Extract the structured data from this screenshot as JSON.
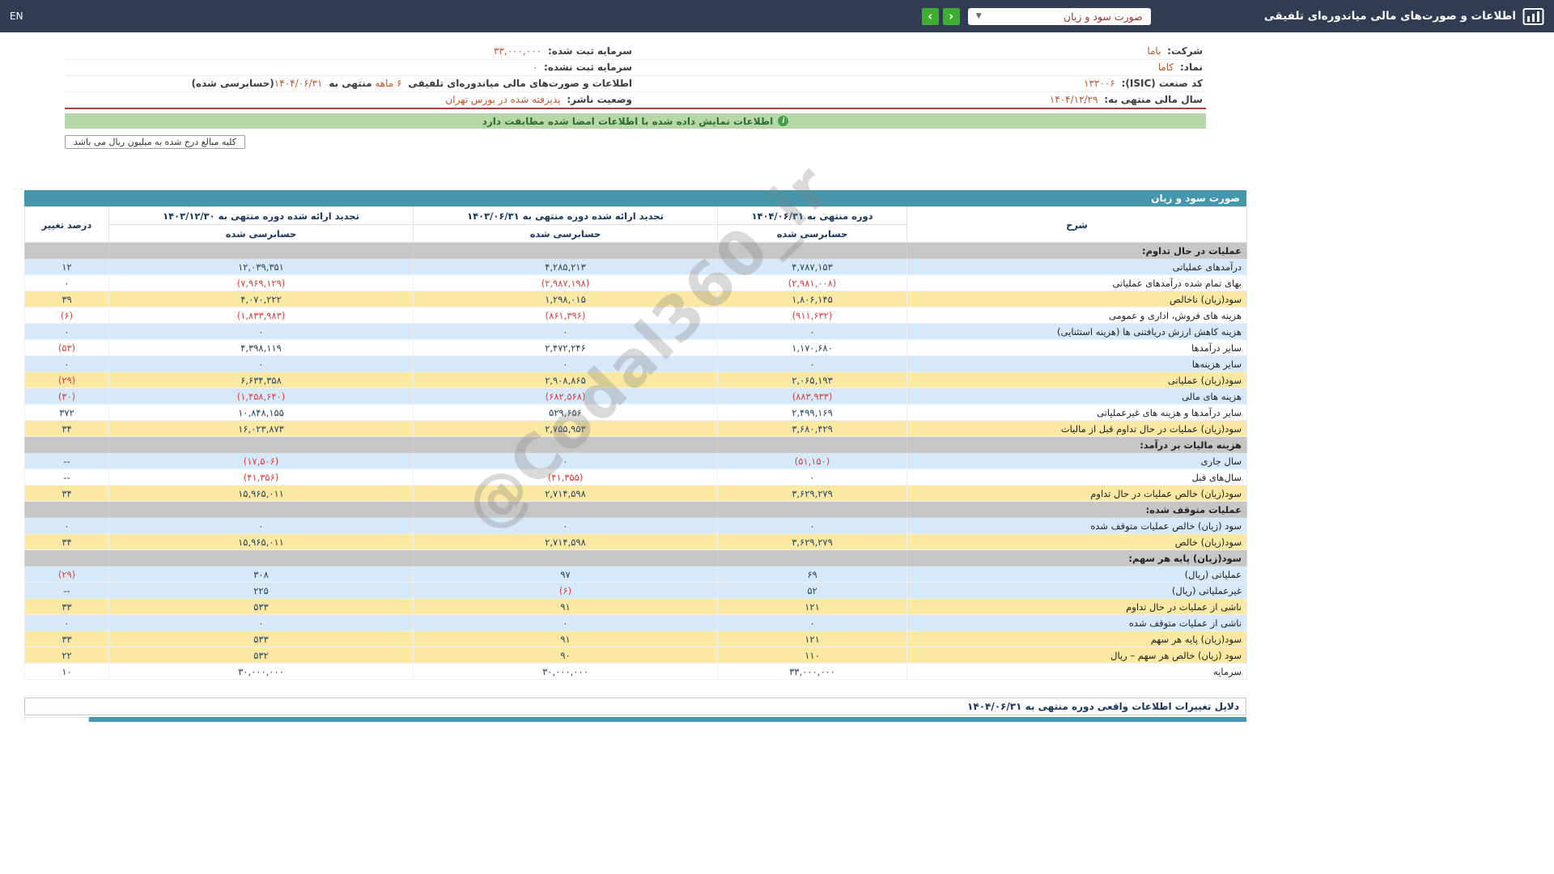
{
  "topbar": {
    "en": "EN",
    "title": "اطلاعات و صورت‌های مالی میاندوره‌ای تلفیقی",
    "statement_dropdown": "صورت سود و زیان",
    "nav_prev": "‹",
    "nav_next": "›"
  },
  "company_info": {
    "company_label": "شرکت:",
    "company_value": "باما",
    "symbol_label": "نماد:",
    "symbol_value": "کاما",
    "isic_label": "کد صنعت (ISIC):",
    "isic_value": "۱۳۲۰۰۶",
    "fiscal_year_label": "سال مالی منتهی به:",
    "fiscal_year_value": "۱۴۰۴/۱۲/۲۹",
    "registered_capital_label": "سرمایه ثبت شده:",
    "registered_capital_value": "۳۳,۰۰۰,۰۰۰",
    "unregistered_capital_label": "سرمایه ثبت نشده:",
    "unregistered_capital_value": "۰",
    "report_desc_prefix": "اطلاعات و صورت‌های مالی میاندوره‌ای تلفیقی",
    "report_desc_period": "۶ ماهه",
    "report_desc_middle": "منتهی به",
    "report_desc_date": "۱۴۰۴/۰۶/۳۱",
    "report_desc_suffix": "(حسابرسی شده)",
    "issuer_status_label": "وضعیت ناشر:",
    "issuer_status_value": "پذیرفته شده در بورس تهران"
  },
  "notice": {
    "text": "اطلاعات نمایش داده شده با اطلاعات امضا شده مطابقت دارد"
  },
  "amounts_note": "کلیه مبالغ درج شده به میلیون ریال می باشد",
  "statement_table": {
    "title": "صورت سود و زیان",
    "col_desc": "شرح",
    "col_period1": "دوره منتهی به ۱۴۰۴/۰۶/۳۱",
    "col_period2": "تجدید ارائه شده دوره منتهی به ۱۴۰۳/۰۶/۳۱",
    "col_period3": "تجدید ارائه شده دوره منتهی به ۱۴۰۳/۱۲/۳۰",
    "col_pct": "درصد تغییر",
    "audited_label": "حسابرسی شده",
    "rows": [
      {
        "label": "عملیات در حال تداوم:",
        "style": "section",
        "v1": "",
        "v2": "",
        "v3": "",
        "pct": ""
      },
      {
        "label": "درآمدهای عملیاتی",
        "style": "blue",
        "v1": "۴,۷۸۷,۱۵۳",
        "v2": "۴,۲۸۵,۲۱۳",
        "v3": "۱۲,۰۳۹,۳۵۱",
        "pct": "۱۲"
      },
      {
        "label": "بهای تمام شده درآمدهای عملیاتی",
        "style": "white",
        "v1": "(۲,۹۸۱,۰۰۸)",
        "v2": "(۲,۹۸۷,۱۹۸)",
        "v3": "(۷,۹۶۹,۱۲۹)",
        "pct": "۰"
      },
      {
        "label": "سود(زیان) ناخالص",
        "style": "yellow",
        "v1": "۱,۸۰۶,۱۴۵",
        "v2": "۱,۲۹۸,۰۱۵",
        "v3": "۴,۰۷۰,۲۲۲",
        "pct": "۳۹"
      },
      {
        "label": "هزینه های فروش، اداری و عمومی",
        "style": "white",
        "v1": "(۹۱۱,۶۳۲)",
        "v2": "(۸۶۱,۳۹۶)",
        "v3": "(۱,۸۳۳,۹۸۳)",
        "pct": "(۶)"
      },
      {
        "label": "هزینه کاهش ارزش دریافتنی ها (هزینه استثنایی)",
        "style": "blue",
        "v1": "۰",
        "v2": "۰",
        "v3": "۰",
        "pct": "۰"
      },
      {
        "label": "سایر درآمدها",
        "style": "white",
        "v1": "۱,۱۷۰,۶۸۰",
        "v2": "۲,۴۷۲,۲۴۶",
        "v3": "۴,۳۹۸,۱۱۹",
        "pct": "(۵۳)"
      },
      {
        "label": "سایر هزینه‌ها",
        "style": "blue",
        "v1": "۰",
        "v2": "۰",
        "v3": "۰",
        "pct": "۰"
      },
      {
        "label": "سود(زیان) عملیاتی",
        "style": "yellow",
        "v1": "۲,۰۶۵,۱۹۳",
        "v2": "۲,۹۰۸,۸۶۵",
        "v3": "۶,۶۳۴,۳۵۸",
        "pct": "(۲۹)"
      },
      {
        "label": "هزینه های مالی",
        "style": "blue",
        "v1": "(۸۸۳,۹۳۳)",
        "v2": "(۶۸۲,۵۶۸)",
        "v3": "(۱,۴۵۸,۶۴۰)",
        "pct": "(۳۰)"
      },
      {
        "label": "سایر درآمدها و هزینه های غیرعملیاتی",
        "style": "white",
        "v1": "۲,۴۹۹,۱۶۹",
        "v2": "۵۲۹,۶۵۶",
        "v3": "۱۰,۸۴۸,۱۵۵",
        "pct": "۳۷۲"
      },
      {
        "label": "سود(زیان) عملیات در حال تداوم قبل از مالیات",
        "style": "yellow",
        "v1": "۳,۶۸۰,۴۲۹",
        "v2": "۲,۷۵۵,۹۵۳",
        "v3": "۱۶,۰۲۳,۸۷۳",
        "pct": "۳۴"
      },
      {
        "label": "هزینه مالیات بر درآمد:",
        "style": "section",
        "v1": "",
        "v2": "",
        "v3": "",
        "pct": ""
      },
      {
        "label": "سال جاری",
        "style": "blue",
        "v1": "(۵۱,۱۵۰)",
        "v2": "۰",
        "v3": "(۱۷,۵۰۶)",
        "pct": "--"
      },
      {
        "label": "سال‌های قبل",
        "style": "white",
        "v1": "۰",
        "v2": "(۴۱,۳۵۵)",
        "v3": "(۴۱,۳۵۶)",
        "pct": "--"
      },
      {
        "label": "سود(زیان) خالص عملیات در حال تداوم",
        "style": "yellow",
        "v1": "۳,۶۲۹,۲۷۹",
        "v2": "۲,۷۱۴,۵۹۸",
        "v3": "۱۵,۹۶۵,۰۱۱",
        "pct": "۳۴"
      },
      {
        "label": "عملیات متوقف شده:",
        "style": "section",
        "v1": "",
        "v2": "",
        "v3": "",
        "pct": ""
      },
      {
        "label": "سود (زیان) خالص عملیات متوقف شده",
        "style": "blue",
        "v1": "۰",
        "v2": "۰",
        "v3": "۰",
        "pct": "۰"
      },
      {
        "label": "سود(زیان) خالص",
        "style": "yellow",
        "v1": "۳,۶۲۹,۲۷۹",
        "v2": "۲,۷۱۴,۵۹۸",
        "v3": "۱۵,۹۶۵,۰۱۱",
        "pct": "۳۴"
      },
      {
        "label": "سود(زیان) پایه هر سهم:",
        "style": "section",
        "v1": "",
        "v2": "",
        "v3": "",
        "pct": ""
      },
      {
        "label": "عملیاتی (ریال)",
        "style": "blue",
        "v1": "۶۹",
        "v2": "۹۷",
        "v3": "۳۰۸",
        "pct": "(۲۹)"
      },
      {
        "label": "غیرعملیاتی (ریال)",
        "style": "blue",
        "v1": "۵۲",
        "v2": "(۶)",
        "v3": "۲۲۵",
        "pct": "--"
      },
      {
        "label": "ناشی از عملیات در حال تداوم",
        "style": "yellow",
        "v1": "۱۲۱",
        "v2": "۹۱",
        "v3": "۵۳۳",
        "pct": "۳۳"
      },
      {
        "label": "ناشی از عملیات متوقف شده",
        "style": "blue",
        "v1": "۰",
        "v2": "۰",
        "v3": "۰",
        "pct": "۰"
      },
      {
        "label": "سود(زیان) پایه هر سهم",
        "style": "yellow",
        "v1": "۱۲۱",
        "v2": "۹۱",
        "v3": "۵۳۳",
        "pct": "۳۳"
      },
      {
        "label": "سود (زیان) خالص هر سهم – ریال",
        "style": "yellow",
        "v1": "۱۱۰",
        "v2": "۹۰",
        "v3": "۵۳۲",
        "pct": "۲۲"
      },
      {
        "label": "سرمایه",
        "style": "white",
        "v1": "۳۳,۰۰۰,۰۰۰",
        "v2": "۳۰,۰۰۰,۰۰۰",
        "v3": "۳۰,۰۰۰,۰۰۰",
        "pct": "۱۰"
      }
    ]
  },
  "footer": {
    "reasons_title": "دلایل تغییرات اطلاعات واقعی دوره منتهی به ۱۴۰۴/۰۶/۳۱"
  },
  "watermark": "@Codal360_ir",
  "colors": {
    "topbar_bg": "#313c53",
    "accent_teal": "#4597ac",
    "success_green": "#3dae2f",
    "banner_green_bg": "#b6d8a9",
    "row_blue": "#d6e9f8",
    "row_yellow": "#fbe8a2",
    "row_section_gray": "#c6c6c6",
    "negative_red": "#e03c3c",
    "value_orange": "#c3532a"
  }
}
